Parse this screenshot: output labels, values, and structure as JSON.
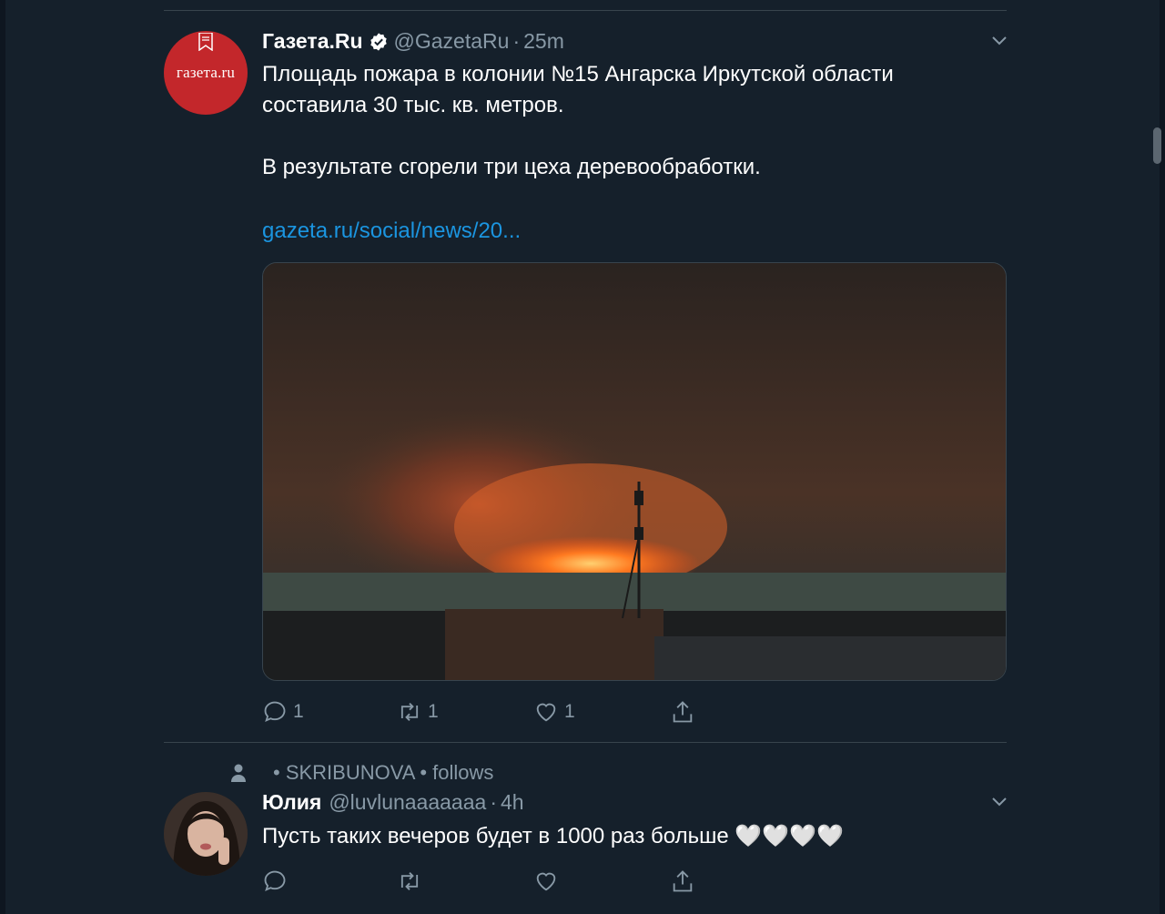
{
  "tweets": [
    {
      "avatar_text": "газета.ru",
      "name": "Газета.Ru",
      "handle": "@GazetaRu",
      "separator": "·",
      "time": "25m",
      "text": "Площадь пожара в колонии №15 Ангарска Иркутской области\nсоставила 30 тыс. кв. метров.\n\nВ результате сгорели три цеха деревообработки.",
      "link": "gazeta.ru/social/news/20...",
      "actions": {
        "reply_count": "1",
        "retweet_count": "1",
        "like_count": "1"
      }
    },
    {
      "context": "• SKRIBUNOVA • follows",
      "name": "Юлия",
      "handle": "@luvlunaaaaaaa",
      "separator": "·",
      "time": "4h",
      "text": "Пусть таких вечеров будет в 1000 раз больше 🤍🤍🤍🤍",
      "actions": {
        "reply_count": "",
        "retweet_count": "",
        "like_count": ""
      }
    }
  ],
  "icons": {
    "verified": "verified-badge-icon",
    "caret": "chevron-down-icon",
    "reply": "reply-icon",
    "retweet": "retweet-icon",
    "like": "heart-icon",
    "share": "share-icon",
    "context": "person-icon"
  },
  "colors": {
    "background": "#15202b",
    "link": "#1b95e0",
    "muted": "#8899a6",
    "brand": "#c3272b"
  }
}
